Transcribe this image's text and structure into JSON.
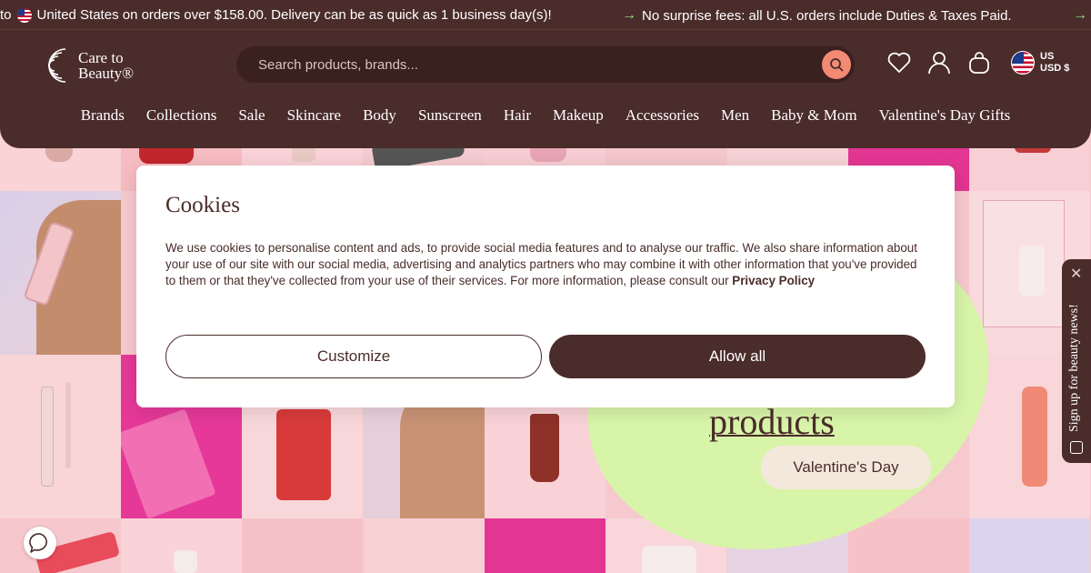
{
  "announcement": {
    "message_1": "to",
    "message_1b": "United States on orders over $158.00. Delivery can be as quick as 1 business day(s)!",
    "message_2": "No surprise fees: all U.S. orders include Duties & Taxes Paid.",
    "arrow_icon": "arrow-right-icon"
  },
  "header": {
    "logo_line1": "Care to",
    "logo_line2": "Beauty®",
    "search_placeholder": "Search products, brands...",
    "region_country": "US",
    "region_currency": "USD $",
    "icons": [
      "heart-icon",
      "user-icon",
      "bag-icon"
    ]
  },
  "nav": {
    "items": [
      "Brands",
      "Collections",
      "Sale",
      "Skincare",
      "Body",
      "Sunscreen",
      "Hair",
      "Makeup",
      "Accessories",
      "Men",
      "Baby & Mom",
      "Valentine's Day Gifts"
    ]
  },
  "hero": {
    "link_text": "products",
    "button_label": "Valentine's Day"
  },
  "newsletter_tab": {
    "label": "Sign up for beauty news!"
  },
  "cookies": {
    "title": "Cookies",
    "body": "We use cookies to personalise content and ads, to provide social media features and to analyse our traffic. We also share information about your use of our site with our social media, advertising and analytics partners who may combine it with other information that you've provided to them or that they've collected from your use of their services. For more information, please consult our",
    "policy_link": "Privacy Policy",
    "customize_label": "Customize",
    "allow_label": "Allow all"
  },
  "colors": {
    "brand": "#4a2c2a",
    "accent": "#f28a74",
    "hero_blob": "#d7f4a8",
    "background": "#f6c9cf"
  }
}
